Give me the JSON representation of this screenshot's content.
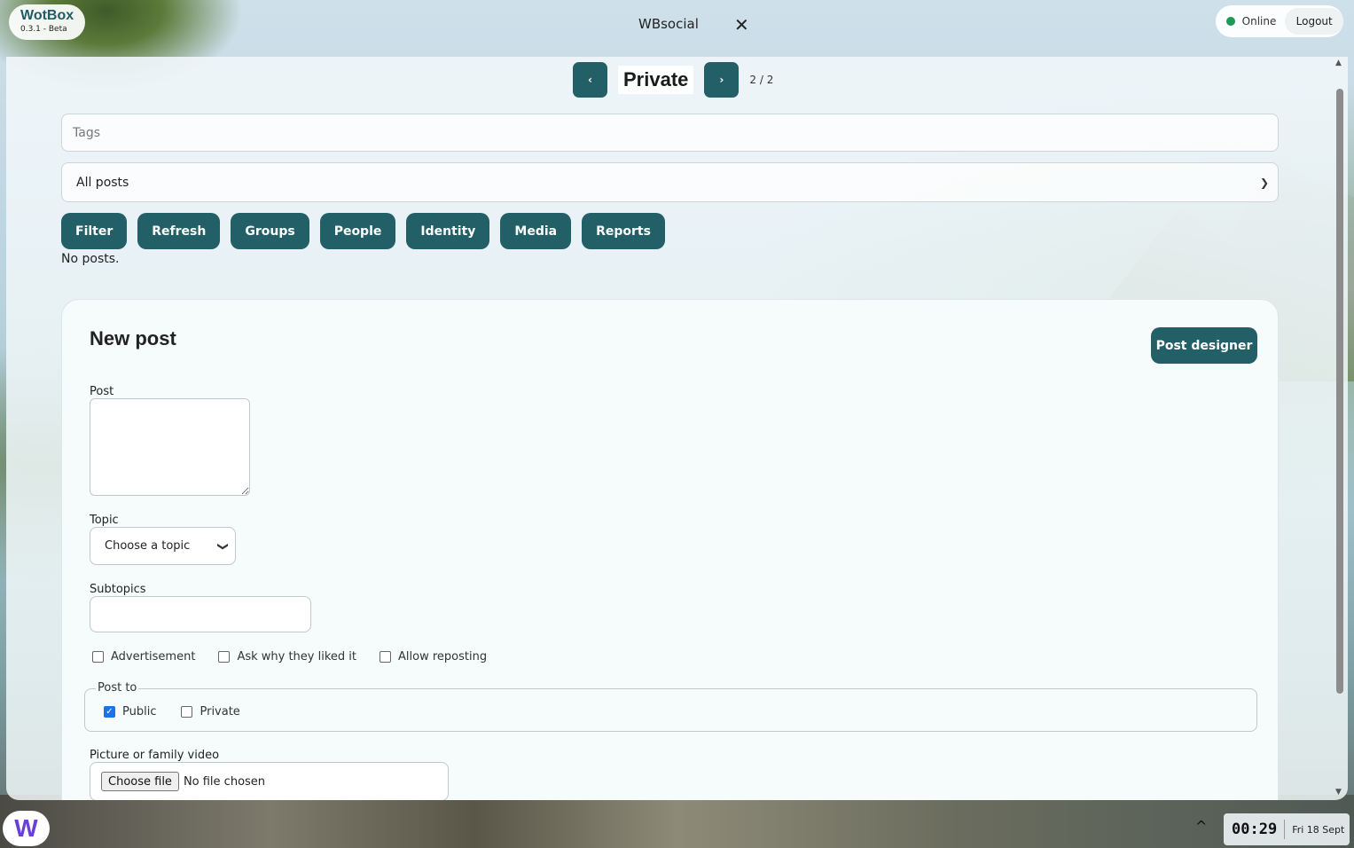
{
  "brand": {
    "name": "WotBox",
    "version": "0.3.1 - Beta"
  },
  "window": {
    "title": "WBsocial",
    "close_glyph": "✕"
  },
  "status": {
    "text": "Online",
    "logout_label": "Logout",
    "dot_color": "#1f9a55"
  },
  "pager": {
    "prev_glyph": "‹",
    "next_glyph": "›",
    "title": "Private",
    "count": "2 / 2"
  },
  "filters": {
    "tags_placeholder": "Tags",
    "posts_select_value": "All posts",
    "buttons": [
      "Filter",
      "Refresh",
      "Groups",
      "People",
      "Identity",
      "Media",
      "Reports"
    ],
    "empty_text": "No posts."
  },
  "new_post": {
    "title": "New post",
    "designer_label": "Post designer",
    "post_label": "Post",
    "topic_label": "Topic",
    "topic_value": "Choose a topic",
    "subtopics_label": "Subtopics",
    "options": [
      {
        "label": "Advertisement",
        "checked": false
      },
      {
        "label": "Ask why they liked it",
        "checked": false
      },
      {
        "label": "Allow reposting",
        "checked": false
      }
    ],
    "post_to_label": "Post to",
    "post_to": [
      {
        "label": "Public",
        "checked": true
      },
      {
        "label": "Private",
        "checked": false
      }
    ],
    "file_label": "Picture or family video",
    "file_button": "Choose file",
    "file_status": "No file chosen"
  },
  "taskbar": {
    "launcher_glyph": "W",
    "tray_glyph": "^",
    "time": "00:29",
    "date": "Fri 18 Sept"
  },
  "colors": {
    "accent": "#235f66",
    "launcher": "#6a3fd8",
    "checkbox": "#1a73e8"
  }
}
